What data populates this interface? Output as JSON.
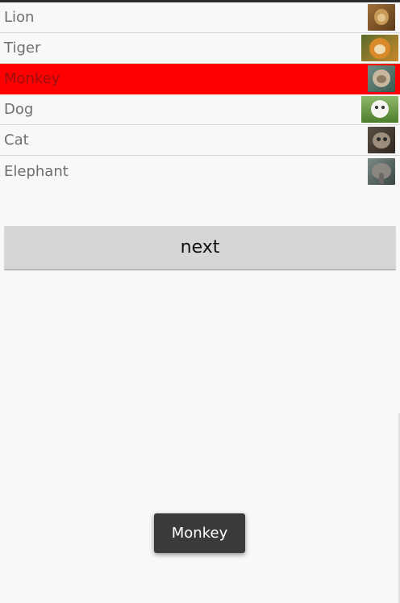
{
  "list": {
    "items": [
      {
        "label": "Lion",
        "icon": "lion-thumbnail-icon",
        "selected": false
      },
      {
        "label": "Tiger",
        "icon": "tiger-thumbnail-icon",
        "selected": false
      },
      {
        "label": "Monkey",
        "icon": "monkey-thumbnail-icon",
        "selected": true
      },
      {
        "label": "Dog",
        "icon": "dog-thumbnail-icon",
        "selected": false
      },
      {
        "label": "Cat",
        "icon": "cat-thumbnail-icon",
        "selected": false
      },
      {
        "label": "Elephant",
        "icon": "elephant-thumbnail-icon",
        "selected": false
      }
    ],
    "selected_color": "#ff0000"
  },
  "next_button": {
    "label": "next"
  },
  "toast": {
    "text": "Monkey"
  }
}
